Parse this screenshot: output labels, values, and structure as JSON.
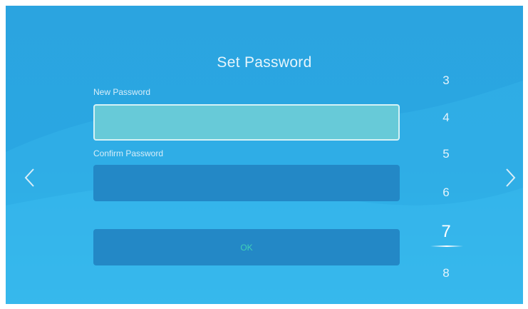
{
  "dialog": {
    "title": "Set Password",
    "new_password_label": "New Password",
    "confirm_password_label": "Confirm Password",
    "ok_label": "OK"
  },
  "number_picker": {
    "items": [
      "3",
      "4",
      "5",
      "6",
      "7",
      "8"
    ],
    "selected": "7"
  },
  "navigation": {
    "left_icon": "chevron-left-icon",
    "right_icon": "chevron-right-icon"
  },
  "colors": {
    "background": "#2aa7e2",
    "active_input": "#67cad8",
    "inactive_input": "#2388c6",
    "ok_text": "#3fd0b8"
  }
}
